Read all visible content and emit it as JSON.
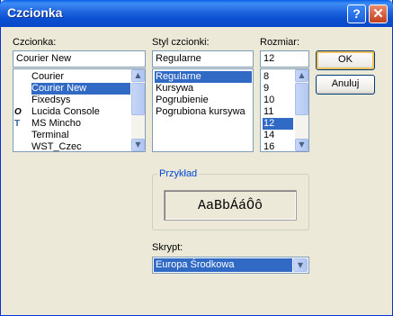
{
  "window": {
    "title": "Czcionka",
    "help_label": "?",
    "close_label": "✕"
  },
  "font": {
    "label": "Czcionka:",
    "value": "Courier New",
    "items": [
      {
        "label": "Courier",
        "icon": "",
        "selected": false
      },
      {
        "label": "Courier New",
        "icon": "opentype-icon",
        "selected": true
      },
      {
        "label": "Fixedsys",
        "icon": "",
        "selected": false
      },
      {
        "label": "Lucida Console",
        "icon": "opentype-icon",
        "selected": false
      },
      {
        "label": "MS Mincho",
        "icon": "truetype-icon",
        "selected": false
      },
      {
        "label": "Terminal",
        "icon": "",
        "selected": false
      },
      {
        "label": "WST_Czec",
        "icon": "",
        "selected": false
      }
    ]
  },
  "style": {
    "label": "Styl czcionki:",
    "value": "Regularne",
    "items": [
      {
        "label": "Regularne",
        "selected": true
      },
      {
        "label": "Kursywa",
        "selected": false
      },
      {
        "label": "Pogrubienie",
        "selected": false
      },
      {
        "label": "Pogrubiona kursywa",
        "selected": false
      }
    ]
  },
  "size": {
    "label": "Rozmiar:",
    "value": "12",
    "items": [
      {
        "label": "8",
        "selected": false
      },
      {
        "label": "9",
        "selected": false
      },
      {
        "label": "10",
        "selected": false
      },
      {
        "label": "11",
        "selected": false
      },
      {
        "label": "12",
        "selected": true
      },
      {
        "label": "14",
        "selected": false
      },
      {
        "label": "16",
        "selected": false
      }
    ]
  },
  "buttons": {
    "ok": "OK",
    "cancel": "Anuluj"
  },
  "sample": {
    "label": "Przykład",
    "text": "AaBbÁáÔô"
  },
  "script": {
    "label": "Skrypt:",
    "value": "Europa Środkowa"
  },
  "colors": {
    "selection": "#316ac5",
    "group_title": "#0046d5",
    "dialog_bg": "#ece9d8"
  }
}
